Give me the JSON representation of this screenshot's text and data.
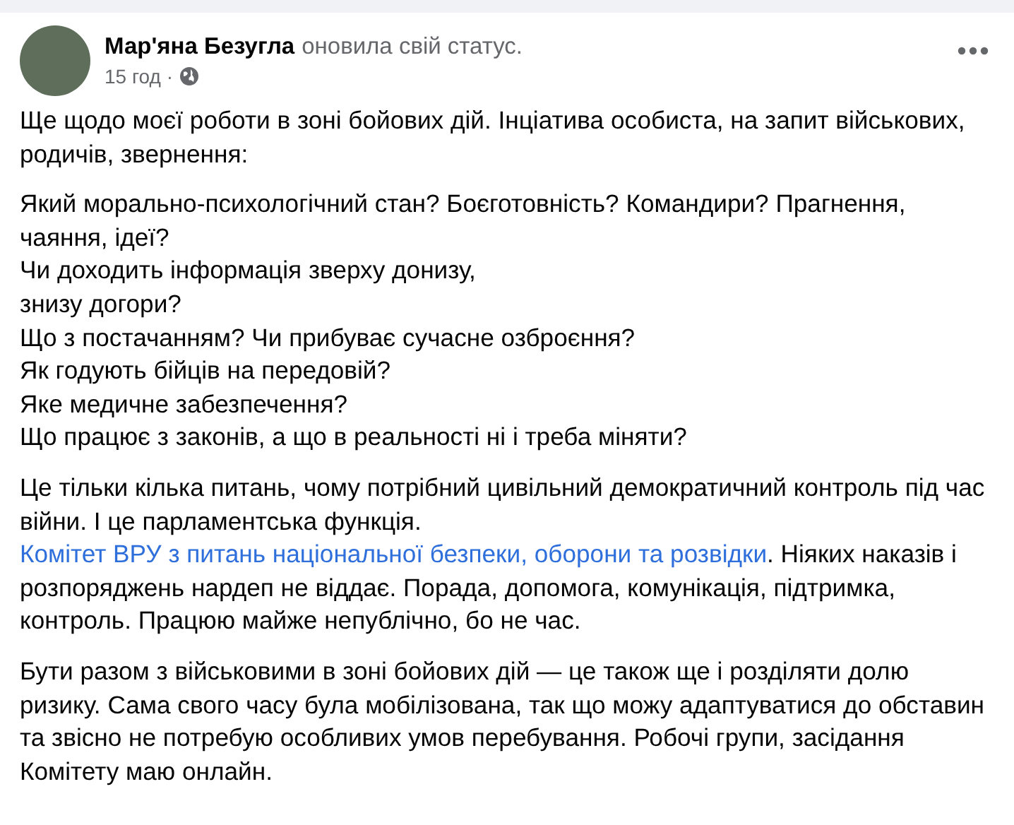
{
  "post": {
    "author": "Мар'яна Безугла",
    "action": "оновила свій статус.",
    "time": "15 год",
    "separator": "·"
  },
  "paragraphs": [
    {
      "kind": "text",
      "lines": [
        "Ще щодо моєї роботи в зоні бойових дій. Інціатива особиста, на запит військових, родичів, звернення:"
      ]
    },
    {
      "kind": "text",
      "lines": [
        "Який морально-психологічний стан? Боєготовність? Командири? Прагнення, чаяння, ідеї?",
        "Чи доходить інформація зверху донизу,",
        "знизу догори?",
        "Що з постачанням? Чи прибуває сучасне озброєння?",
        "Як годують бійців на передовій?",
        "Яке медичне забезпечення?",
        "Що працює з законів, а що в реальності ні і треба міняти?"
      ]
    },
    {
      "kind": "with_link",
      "before": "Це тільки кілька питань, чому потрібний цивільний демократичний контроль під час війни. І це парламентська функція.",
      "link": "Комітет ВРУ з питань національної безпеки, оборони та розвідки",
      "after": ". Ніяких наказів і розпоряджень нардеп не віддає. Порада, допомога, комунікація, підтримка, контроль. Працюю майже непублічно, бо не час."
    },
    {
      "kind": "text",
      "lines": [
        "Бути разом з військовими в зоні бойових дій — це також ще і розділяти долю ризику. Сама свого часу була мобілізована, так що можу адаптуватися до обставин та звісно не потребую особливих умов перебування. Робочі групи, засідання Комітету маю онлайн."
      ]
    }
  ]
}
